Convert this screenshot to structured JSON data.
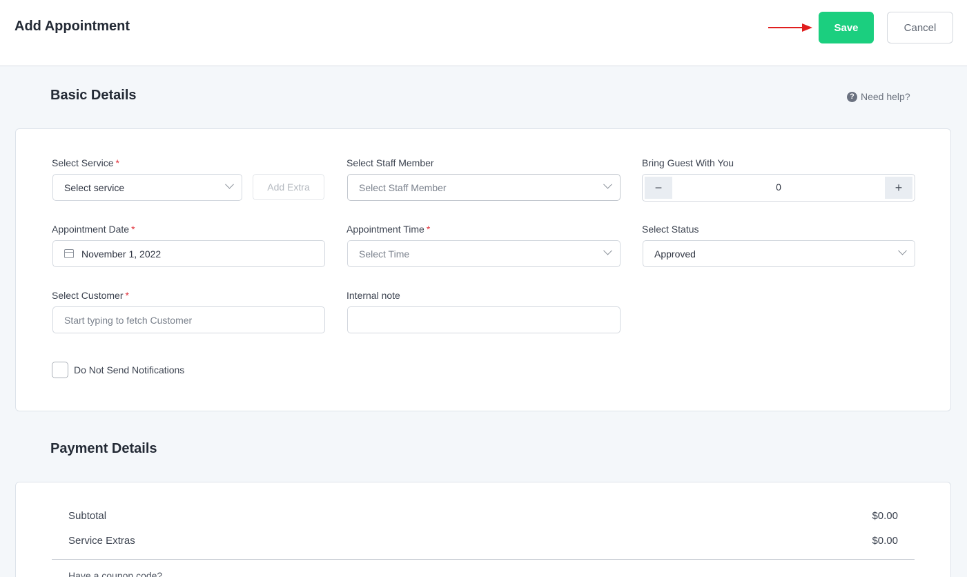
{
  "header": {
    "title": "Add Appointment",
    "save_label": "Save",
    "cancel_label": "Cancel",
    "accent_color": "#1bcf7f",
    "arrow_color": "#e01e1e"
  },
  "basic": {
    "title": "Basic Details",
    "help_label": "Need help?",
    "service": {
      "label": "Select Service",
      "required": "*",
      "placeholder": "Select service",
      "extra_label": "Add Extra"
    },
    "staff": {
      "label": "Select Staff Member",
      "placeholder": "Select Staff Member"
    },
    "guests": {
      "label": "Bring Guest With You",
      "value": "0",
      "minus": "−",
      "plus": "+"
    },
    "date": {
      "label": "Appointment Date",
      "required": "*",
      "value": "November 1, 2022"
    },
    "time": {
      "label": "Appointment Time",
      "required": "*",
      "placeholder": "Select Time"
    },
    "status": {
      "label": "Select Status",
      "value": "Approved"
    },
    "customer": {
      "label": "Select Customer",
      "required": "*",
      "placeholder": "Start typing to fetch Customer"
    },
    "note": {
      "label": "Internal note",
      "value": ""
    },
    "notify_label": "Do Not Send Notifications"
  },
  "payment": {
    "title": "Payment Details",
    "rows": [
      {
        "label": "Subtotal",
        "amount": "$0.00"
      },
      {
        "label": "Service Extras",
        "amount": "$0.00"
      }
    ],
    "coupon_label": "Have a coupon code?"
  }
}
